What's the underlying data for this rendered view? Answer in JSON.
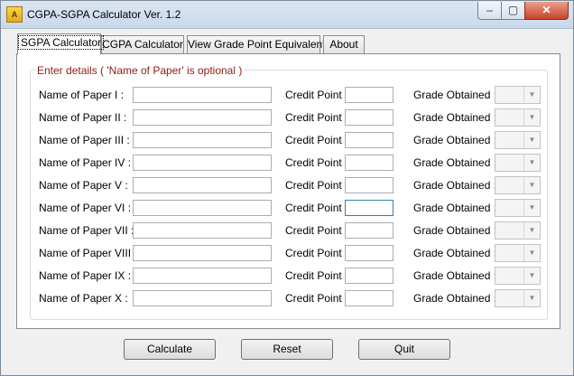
{
  "window": {
    "title": "CGPA-SGPA Calculator Ver. 1.2",
    "controls": {
      "minimize": "‒",
      "maximize": "▢",
      "close": "✕"
    }
  },
  "tabs": [
    {
      "label": "SGPA Calculator",
      "active": true
    },
    {
      "label": "CGPA Calculator",
      "active": false
    },
    {
      "label": "View Grade Point Equivalent",
      "active": false
    },
    {
      "label": "About",
      "active": false
    }
  ],
  "group": {
    "legend": "Enter details ( 'Name of Paper' is optional )"
  },
  "rows": [
    {
      "paper_label": "Name of Paper I :",
      "paper_value": "",
      "credit_label": "Credit Point :",
      "credit_value": "",
      "grade_label": "Grade Obtained :",
      "grade_value": ""
    },
    {
      "paper_label": "Name of Paper II :",
      "paper_value": "",
      "credit_label": "Credit Point :",
      "credit_value": "",
      "grade_label": "Grade Obtained :",
      "grade_value": ""
    },
    {
      "paper_label": "Name of Paper III :",
      "paper_value": "",
      "credit_label": "Credit Point :",
      "credit_value": "",
      "grade_label": "Grade Obtained :",
      "grade_value": ""
    },
    {
      "paper_label": "Name of Paper IV :",
      "paper_value": "",
      "credit_label": "Credit Point :",
      "credit_value": "",
      "grade_label": "Grade Obtained :",
      "grade_value": ""
    },
    {
      "paper_label": "Name of Paper V :",
      "paper_value": "",
      "credit_label": "Credit Point :",
      "credit_value": "",
      "grade_label": "Grade Obtained :",
      "grade_value": ""
    },
    {
      "paper_label": "Name of Paper VI :",
      "paper_value": "",
      "credit_label": "Credit Point :",
      "credit_value": "",
      "grade_label": "Grade Obtained :",
      "grade_value": ""
    },
    {
      "paper_label": "Name of Paper VII :",
      "paper_value": "",
      "credit_label": "Credit Point :",
      "credit_value": "",
      "grade_label": "Grade Obtained :",
      "grade_value": ""
    },
    {
      "paper_label": "Name of Paper VIII :",
      "paper_value": "",
      "credit_label": "Credit Point :",
      "credit_value": "",
      "grade_label": "Grade Obtained :",
      "grade_value": ""
    },
    {
      "paper_label": "Name of Paper IX :",
      "paper_value": "",
      "credit_label": "Credit Point :",
      "credit_value": "",
      "grade_label": "Grade Obtained :",
      "grade_value": ""
    },
    {
      "paper_label": "Name of Paper X :",
      "paper_value": "",
      "credit_label": "Credit Point :",
      "credit_value": "",
      "grade_label": "Grade Obtained :",
      "grade_value": ""
    }
  ],
  "buttons": {
    "calculate": "Calculate",
    "reset": "Reset",
    "quit": "Quit"
  }
}
